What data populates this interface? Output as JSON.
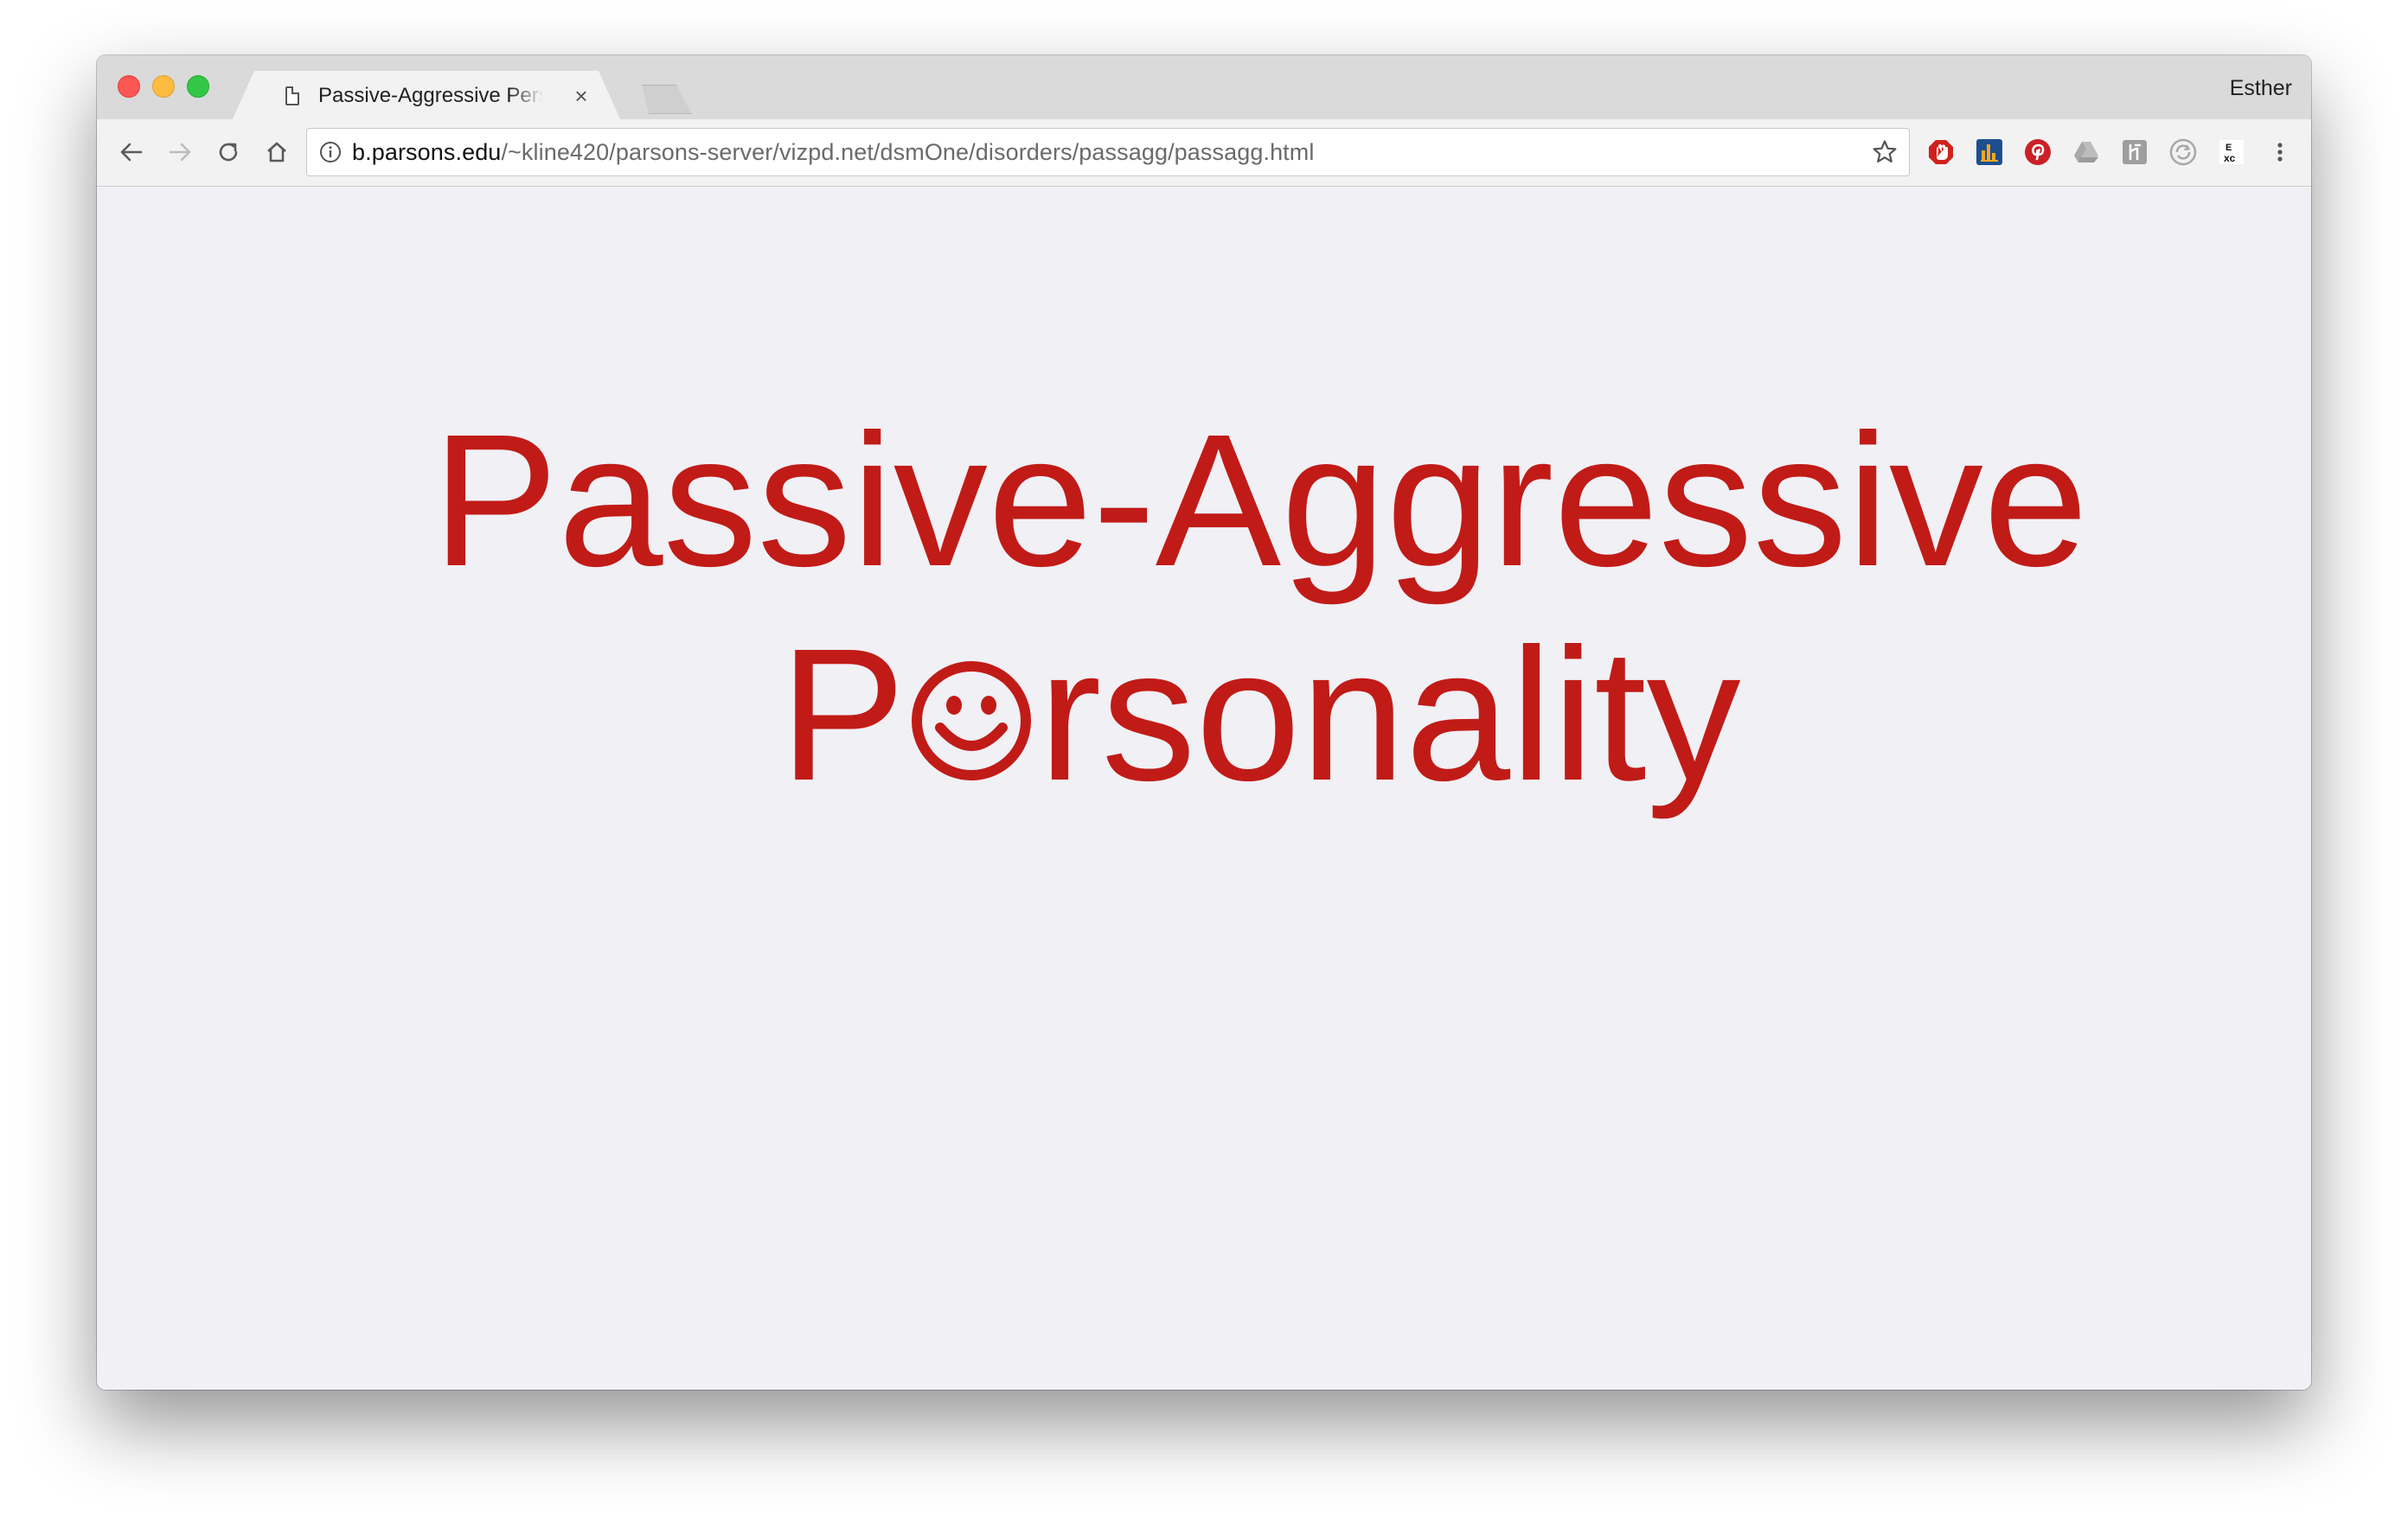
{
  "browser": {
    "tab": {
      "title": "Passive-Aggressive Personality",
      "close_glyph": "×",
      "icon": "document-icon"
    },
    "profile_name": "Esther",
    "toolbar": {
      "back_icon": "back-arrow-icon",
      "forward_icon": "forward-arrow-icon",
      "reload_icon": "reload-icon",
      "home_icon": "home-icon"
    },
    "omnibox": {
      "host": "b.parsons.edu",
      "path": "/~kline420/parsons-server/vizpd.net/dsmOne/disorders/passagg/passagg.html",
      "security_icon": "info-icon",
      "bookmark_icon": "star-icon"
    },
    "extensions": [
      "adblock-icon",
      "analytics-icon",
      "pinterest-icon",
      "drive-icon",
      "reader-icon",
      "sync-icon",
      "excel-icon",
      "menu-icon"
    ]
  },
  "page": {
    "headline_line1": "Passive-Aggressive",
    "headline_line2_start": "P",
    "headline_line2_end": "rsonality",
    "smiley_icon": "smiley-face-icon"
  },
  "colors": {
    "headline": "#c11b17",
    "page_background": "#f0f0f5"
  }
}
